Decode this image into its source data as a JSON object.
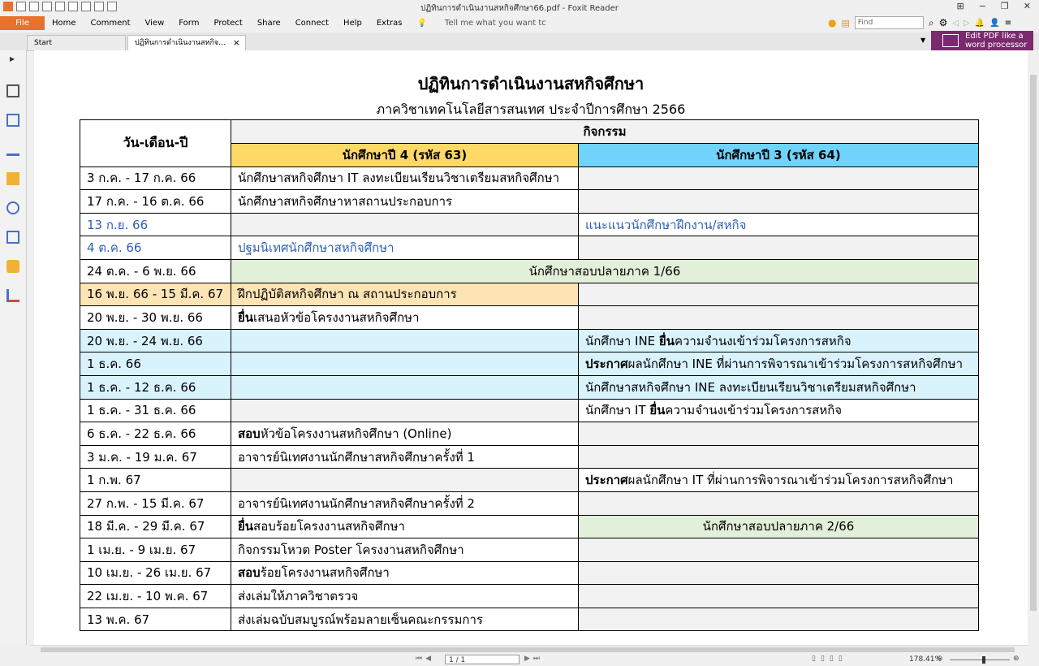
{
  "window": {
    "title": "ปฏิทินการดำเนินงานสหกิจศึกษา66.pdf - Foxit Reader"
  },
  "menu": {
    "file": "File",
    "items": [
      "Home",
      "Comment",
      "View",
      "Form",
      "Protect",
      "Share",
      "Connect",
      "Help",
      "Extras"
    ],
    "tell_me": "Tell me what you want tc",
    "find_placeholder": "Find"
  },
  "tabs": {
    "start": "Start",
    "doc": "ปฏิทินการดำเนินงานสหกิจ...",
    "close": "×"
  },
  "ad": {
    "line1": "Edit PDF like a",
    "line2": "word processor"
  },
  "status": {
    "page": "1 / 1",
    "zoom": "178.41%"
  },
  "doc": {
    "title": "ปฏิทินการดำเนินงานสหกิจศึกษา",
    "subtitle": "ภาควิชาเทคโนโลยีสารสนเทศ ประจำปีการศึกษา 2566",
    "header": {
      "date": "วัน-เดือน-ปี",
      "activity": "กิจกรรม",
      "year4": "นักศึกษาปี 4 (รหัส 63)",
      "year3": "นักศึกษาปี 3 (รหัส 64)"
    },
    "rows": [
      {
        "date": "3 ก.ค. - 17 ก.ค. 66",
        "y4": "นักศึกษาสหกิจศึกษา IT ลงทะเบียนเรียนวิชาเตรียมสหกิจศึกษา",
        "y3": ""
      },
      {
        "date": "17 ก.ค. - 16 ต.ค. 66",
        "y4": "นักศึกษาสหกิจศึกษาหาสถานประกอบการ",
        "y3": ""
      },
      {
        "date": "13 ก.ย. 66",
        "y4": "",
        "y3": "แนะแนวนักศึกษาฝึกงาน/สหกิจ"
      },
      {
        "date": "4 ต.ค. 66",
        "y4": "ปฐมนิเทศนักศึกษาสหกิจศึกษา",
        "y3": ""
      },
      {
        "date": "24 ต.ค. - 6 พ.ย. 66",
        "span": "นักศึกษาสอบปลายภาค 1/66"
      },
      {
        "date": "16 พ.ย. 66 - 15 มี.ค. 67",
        "y4": "ฝึกปฏิบัติสหกิจศึกษา ณ สถานประกอบการ",
        "y3": ""
      },
      {
        "date": "20 พ.ย. - 30 พ.ย. 66",
        "y4_bold": "ยื่น",
        "y4": "เสนอหัวข้อโครงงานสหกิจศึกษา",
        "y3": ""
      },
      {
        "date": "20 พ.ย. - 24 พ.ย. 66",
        "y4": "",
        "y3_pre": "นักศึกษา INE ",
        "y3_bold": "ยื่น",
        "y3": "ความจำนงเข้าร่วมโครงการสหกิจ"
      },
      {
        "date": "1 ธ.ค. 66",
        "y4": "",
        "y3_bold": "ประกาศ",
        "y3": "ผลนักศึกษา INE ที่ผ่านการพิจารณาเข้าร่วมโครงการสหกิจศึกษา"
      },
      {
        "date": "1 ธ.ค. - 12 ธ.ค. 66",
        "y4": "",
        "y3": "นักศึกษาสหกิจศึกษา INE ลงทะเบียนเรียนวิชาเตรียมสหกิจศึกษา"
      },
      {
        "date": "1 ธ.ค. - 31 ธ.ค. 66",
        "y4": "",
        "y3_pre": "นักศึกษา IT ",
        "y3_bold": "ยื่น",
        "y3": "ความจำนงเข้าร่วมโครงการสหกิจ"
      },
      {
        "date": "6 ธ.ค. - 22 ธ.ค. 66",
        "y4_bold": "สอบ",
        "y4": "หัวข้อโครงงานสหกิจศึกษา (Online)",
        "y3": ""
      },
      {
        "date": "3 ม.ค. - 19 ม.ค. 67",
        "y4": "อาจารย์นิเทศงานนักศึกษาสหกิจศึกษาครั้งที่ 1",
        "y3": ""
      },
      {
        "date": "1 ก.พ. 67",
        "y4": "",
        "y3_bold": "ประกาศ",
        "y3": "ผลนักศึกษา IT ที่ผ่านการพิจารณาเข้าร่วมโครงการสหกิจศึกษา"
      },
      {
        "date": "27 ก.พ. - 15 มี.ค. 67",
        "y4": "อาจารย์นิเทศงานนักศึกษาสหกิจศึกษาครั้งที่ 2",
        "y3": ""
      },
      {
        "date": "18 มี.ค. - 29 มี.ค. 67",
        "y4_bold": "ยื่น",
        "y4": "สอบร้อยโครงงานสหกิจศึกษา",
        "y3": "นักศึกษาสอบปลายภาค 2/66"
      },
      {
        "date": "1 เม.ย. - 9 เม.ย. 67",
        "y4": "กิจกรรมโหวต Poster โครงงานสหกิจศึกษา",
        "y3": ""
      },
      {
        "date": "10 เม.ย. - 26 เม.ย. 67",
        "y4_bold": "สอบ",
        "y4": "ร้อยโครงงานสหกิจศึกษา",
        "y3": ""
      },
      {
        "date": "22 เม.ย. - 10 พ.ค. 67",
        "y4": "ส่งเล่มให้ภาควิชาตรวจ",
        "y3": ""
      },
      {
        "date": "13 พ.ค. 67",
        "y4": "ส่งเล่มฉบับสมบูรณ์พร้อมลายเซ็นคณะกรรมการ",
        "y3": ""
      }
    ]
  }
}
